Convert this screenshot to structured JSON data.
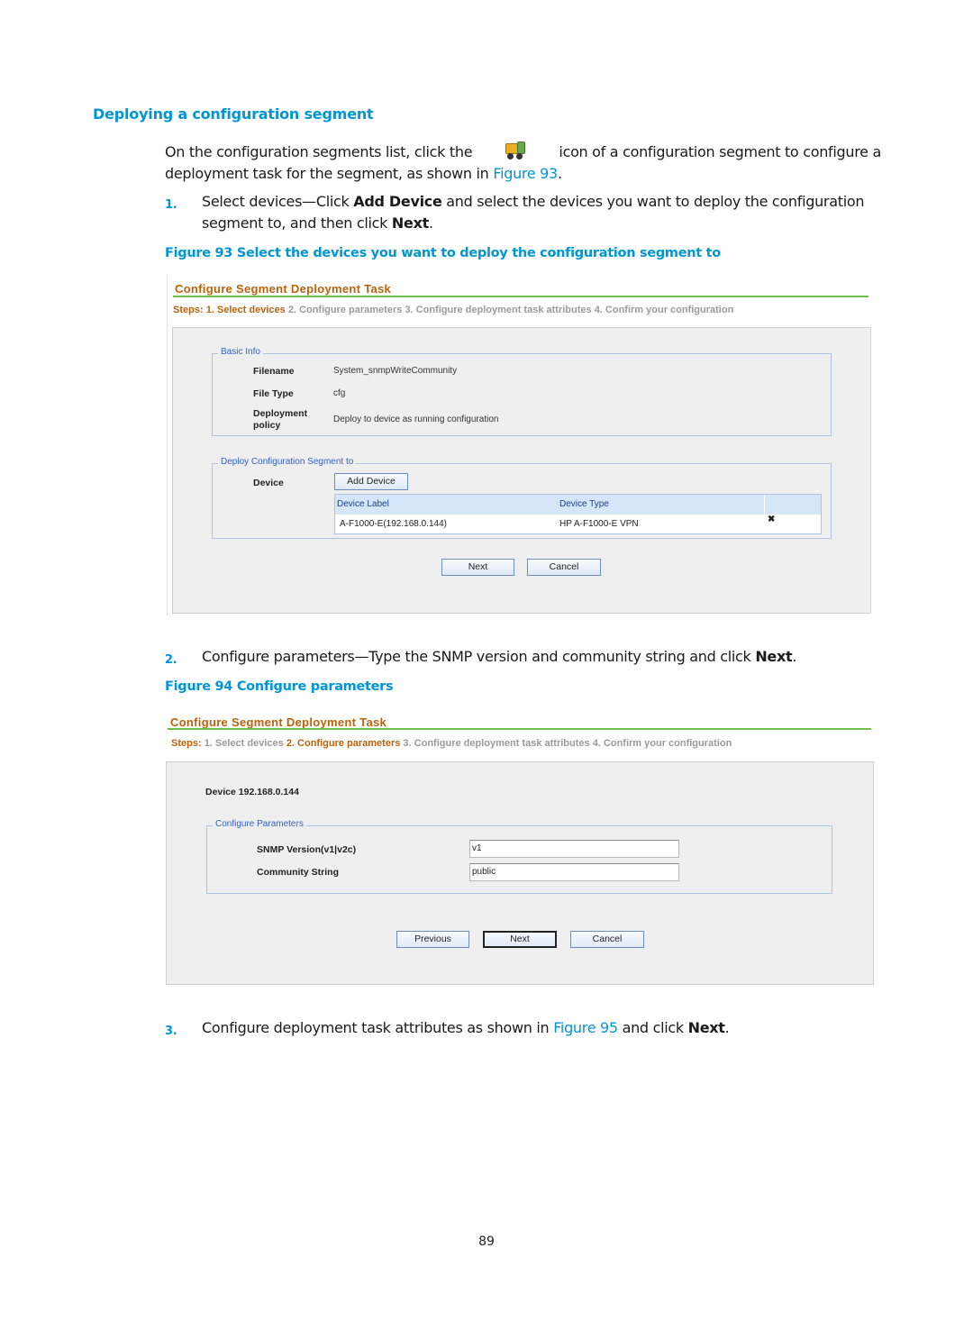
{
  "section": {
    "title": "Deploying a configuration segment"
  },
  "intro": {
    "before_icon": "On the configuration segments list, click the",
    "icon": "deploy-truck-icon",
    "after_icon_line1": "icon of a configuration segment to configure a",
    "line2_prefix": "deployment task for the segment, as shown in ",
    "line2_link": "Figure 93",
    "line2_suffix": "."
  },
  "steps": [
    {
      "number": "1.",
      "parts": [
        "Select devices—Click ",
        "Add Device",
        " and select the devices you want to deploy the configuration segment to, and then click ",
        "Next",
        "."
      ]
    },
    {
      "number": "2.",
      "parts": [
        "Configure parameters—Type the SNMP version and community string and click ",
        "Next",
        "."
      ]
    },
    {
      "number": "3.",
      "parts": [
        "Configure deployment task attributes as shown in ",
        "Figure 95",
        " and click ",
        "Next",
        "."
      ]
    }
  ],
  "figure93": {
    "caption": "Figure 93 Select the devices you want to deploy the configuration segment to",
    "ui": {
      "title": "Configure Segment Deployment Task",
      "steps_label": "Steps:",
      "steps": [
        "1. Select devices",
        "2. Configure parameters",
        "3. Configure deployment task attributes",
        "4. Confirm your configuration"
      ],
      "active_step": 1,
      "basic_info": {
        "legend": "Basic Info",
        "fields": [
          {
            "label": "Filename",
            "value": "System_snmpWriteCommunity"
          },
          {
            "label": "File Type",
            "value": "cfg"
          },
          {
            "label": "Deployment policy",
            "value": "Deploy to device as running configuration"
          }
        ]
      },
      "deploy_to": {
        "legend": "Deploy Configuration Segment to",
        "device_label": "Device",
        "add_button": "Add Device",
        "table": {
          "columns": [
            "Device Label",
            "Device Type",
            ""
          ],
          "rows": [
            {
              "device_label": "A-F1000-E(192.168.0.144)",
              "device_type": "HP A-F1000-E VPN",
              "action_icon": "delete-x-icon"
            }
          ]
        }
      },
      "buttons": {
        "next": "Next",
        "cancel": "Cancel"
      }
    }
  },
  "figure94": {
    "caption": "Figure 94 Configure parameters",
    "ui": {
      "title": "Configure Segment Deployment Task",
      "steps_label": "Steps:",
      "steps": [
        "1. Select devices",
        "2. Configure parameters",
        "3. Configure deployment task attributes",
        "4. Confirm your configuration"
      ],
      "active_step": 2,
      "device_heading": "Device 192.168.0.144",
      "params": {
        "legend": "Configure Parameters",
        "fields": [
          {
            "label": "SNMP Version(v1|v2c)",
            "value": "v1"
          },
          {
            "label": "Community String",
            "value": "public"
          }
        ]
      },
      "buttons": {
        "previous": "Previous",
        "next": "Next",
        "cancel": "Cancel"
      }
    }
  },
  "page_number": "89"
}
